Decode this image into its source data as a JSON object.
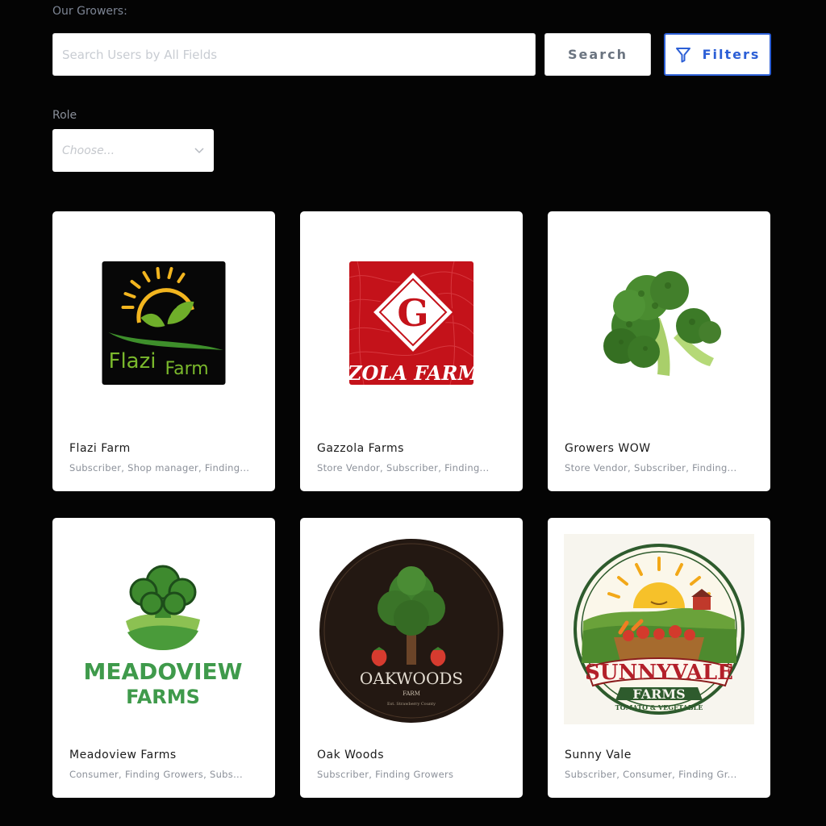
{
  "header": {
    "section_title": "Our Growers:"
  },
  "search": {
    "placeholder": "Search Users by All Fields",
    "button_label": "Search"
  },
  "filters": {
    "button_label": "Filters",
    "icon": "filter-icon"
  },
  "role": {
    "label": "Role",
    "selected_placeholder": "Choose...",
    "icon": "chevron-down-icon"
  },
  "growers": [
    {
      "name": "Flazi Farm",
      "roles": "Subscriber, Shop manager, Finding...",
      "logo_text": [
        "Flazi",
        "Farm"
      ]
    },
    {
      "name": "Gazzola Farms",
      "roles": "Store Vendor, Subscriber, Finding...",
      "logo_text": [
        "G",
        "ZOLA FARM"
      ]
    },
    {
      "name": "Growers WOW",
      "roles": "Store Vendor, Subscriber, Finding..."
    },
    {
      "name": "Meadoview Farms",
      "roles": "Consumer, Finding Growers, Subs...",
      "logo_text": [
        "MEADOVIEW",
        "FARMS"
      ]
    },
    {
      "name": "Oak Woods",
      "roles": "Subscriber, Finding Growers",
      "logo_text": [
        "OAKWOODS",
        "FARM",
        "Est. Strawberry County"
      ]
    },
    {
      "name": "Sunny Vale",
      "roles": "Subscriber, Consumer, Finding Gr...",
      "logo_text": [
        "SUNNYVALE",
        "FARMS",
        "TOMATO & VEGETABLE"
      ]
    }
  ],
  "colors": {
    "background": "#040404",
    "accent": "#2c5fd6",
    "card": "#ffffff"
  }
}
